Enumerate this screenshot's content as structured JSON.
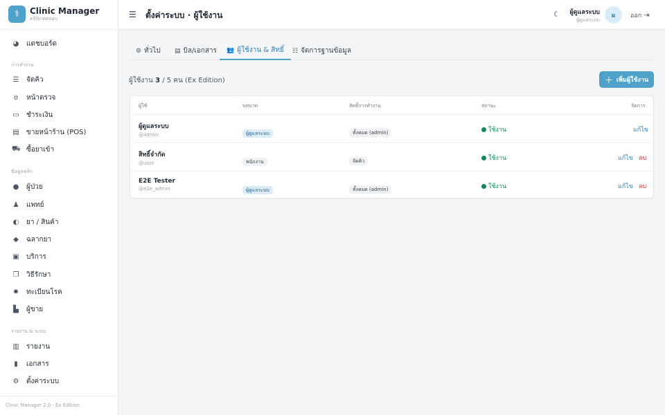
{
  "brand": {
    "title": "Clinic Manager",
    "subtitle": "คลินิกทดสอบ",
    "logo_icon": "tooth-icon"
  },
  "sidebar": {
    "items": [
      {
        "label": "แดชบอร์ด",
        "icon": "dashboard-icon"
      },
      {
        "section": "การทำงาน"
      },
      {
        "label": "จัดคิว",
        "icon": "queue-list-icon"
      },
      {
        "label": "หน้าตรวจ",
        "icon": "stethoscope-icon"
      },
      {
        "label": "ชำระเงิน",
        "icon": "credit-card-icon"
      },
      {
        "label": "ขายหน้าร้าน (POS)",
        "icon": "cash-register-icon"
      },
      {
        "label": "ซื้อยาเข้า",
        "icon": "truck-icon"
      },
      {
        "section": "ข้อมูลหลัก"
      },
      {
        "label": "ผู้ป่วย",
        "icon": "user-icon"
      },
      {
        "label": "แพทย์",
        "icon": "doctor-icon"
      },
      {
        "label": "ยา / สินค้า",
        "icon": "pills-icon"
      },
      {
        "label": "ฉลากยา",
        "icon": "tag-icon"
      },
      {
        "label": "บริการ",
        "icon": "briefcase-medical-icon"
      },
      {
        "label": "วิธีรักษา",
        "icon": "copy-icon"
      },
      {
        "label": "ทะเบียนโรค",
        "icon": "virus-icon"
      },
      {
        "label": "ผู้ขาย",
        "icon": "vendor-icon"
      },
      {
        "section": "รายงาน & ระบบ"
      },
      {
        "label": "รายงาน",
        "icon": "chart-icon"
      },
      {
        "label": "เอกสาร",
        "icon": "file-icon"
      },
      {
        "label": "ตั้งค่าระบบ",
        "icon": "gear-icon"
      }
    ],
    "footer": "Clinic Manager 2.0 · Ex Edition"
  },
  "header": {
    "title": "ตั้งค่าระบบ · ผู้ใช้งาน",
    "user_name": "ผู้ดูแลระบบ",
    "user_role": "ผู้ดูแลระบบ",
    "avatar_initial": "ผ",
    "logout_label": "ออก"
  },
  "tabs": [
    {
      "label": "ทั่วไป",
      "icon": "gear-icon",
      "active": false
    },
    {
      "label": "บิล/เอกสาร",
      "icon": "receipt-icon",
      "active": false
    },
    {
      "label": "ผู้ใช้งาน & สิทธิ์",
      "icon": "users-icon",
      "active": true
    },
    {
      "label": "จัดการฐานข้อมูล",
      "icon": "database-icon",
      "active": false
    }
  ],
  "users_summary": {
    "prefix": "ผู้ใช้งาน",
    "used": "3",
    "rest": "/ 5 คน (Ex Edition)"
  },
  "add_button": "เพิ่มผู้ใช้งาน",
  "table": {
    "columns": [
      "ผู้ใช้",
      "บทบาท",
      "สิทธิ์การทำงาน",
      "สถานะ",
      "จัดการ"
    ],
    "rows": [
      {
        "name": "ผู้ดูแลระบบ",
        "handle": "@admin",
        "role": "ผู้ดูแลระบบ",
        "perm": "ทั้งหมด (admin)",
        "status": "ใช้งาน",
        "edit": "แก้ไข",
        "del": ""
      },
      {
        "name": "สิทธิ์จำกัด",
        "handle": "@user",
        "role": "พนักงาน",
        "perm": "จัดคิว",
        "status": "ใช้งาน",
        "edit": "แก้ไข",
        "del": "ลบ"
      },
      {
        "name": "E2E Tester",
        "handle": "@e2e_admin",
        "role": "ผู้ดูแลระบบ",
        "perm": "ทั้งหมด (admin)",
        "status": "ใช้งาน",
        "edit": "แก้ไข",
        "del": "ลบ"
      }
    ]
  },
  "colors": {
    "accent": "#4ea1c9",
    "success": "#10875a",
    "danger": "#dd3333"
  }
}
